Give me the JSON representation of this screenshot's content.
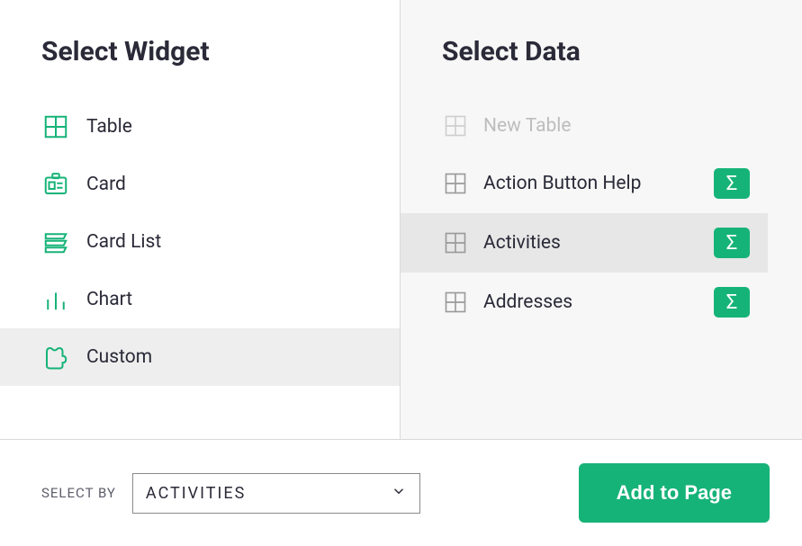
{
  "left": {
    "title": "Select Widget",
    "items": [
      {
        "icon": "table",
        "label": "Table",
        "selected": false
      },
      {
        "icon": "card",
        "label": "Card",
        "selected": false
      },
      {
        "icon": "cardlist",
        "label": "Card List",
        "selected": false
      },
      {
        "icon": "chart",
        "label": "Chart",
        "selected": false
      },
      {
        "icon": "custom",
        "label": "Custom",
        "selected": true
      }
    ]
  },
  "right": {
    "title": "Select Data",
    "items": [
      {
        "label": "New Table",
        "disabled": true,
        "has_summary": false,
        "selected": false
      },
      {
        "label": "Action Button Help",
        "disabled": false,
        "has_summary": true,
        "selected": false
      },
      {
        "label": "Activities",
        "disabled": false,
        "has_summary": true,
        "selected": true
      },
      {
        "label": "Addresses",
        "disabled": false,
        "has_summary": true,
        "selected": false
      }
    ]
  },
  "footer": {
    "select_by_label": "SELECT BY",
    "select_value": "ACTIVITIES",
    "add_button": "Add to Page"
  },
  "summary_glyph": "Σ"
}
